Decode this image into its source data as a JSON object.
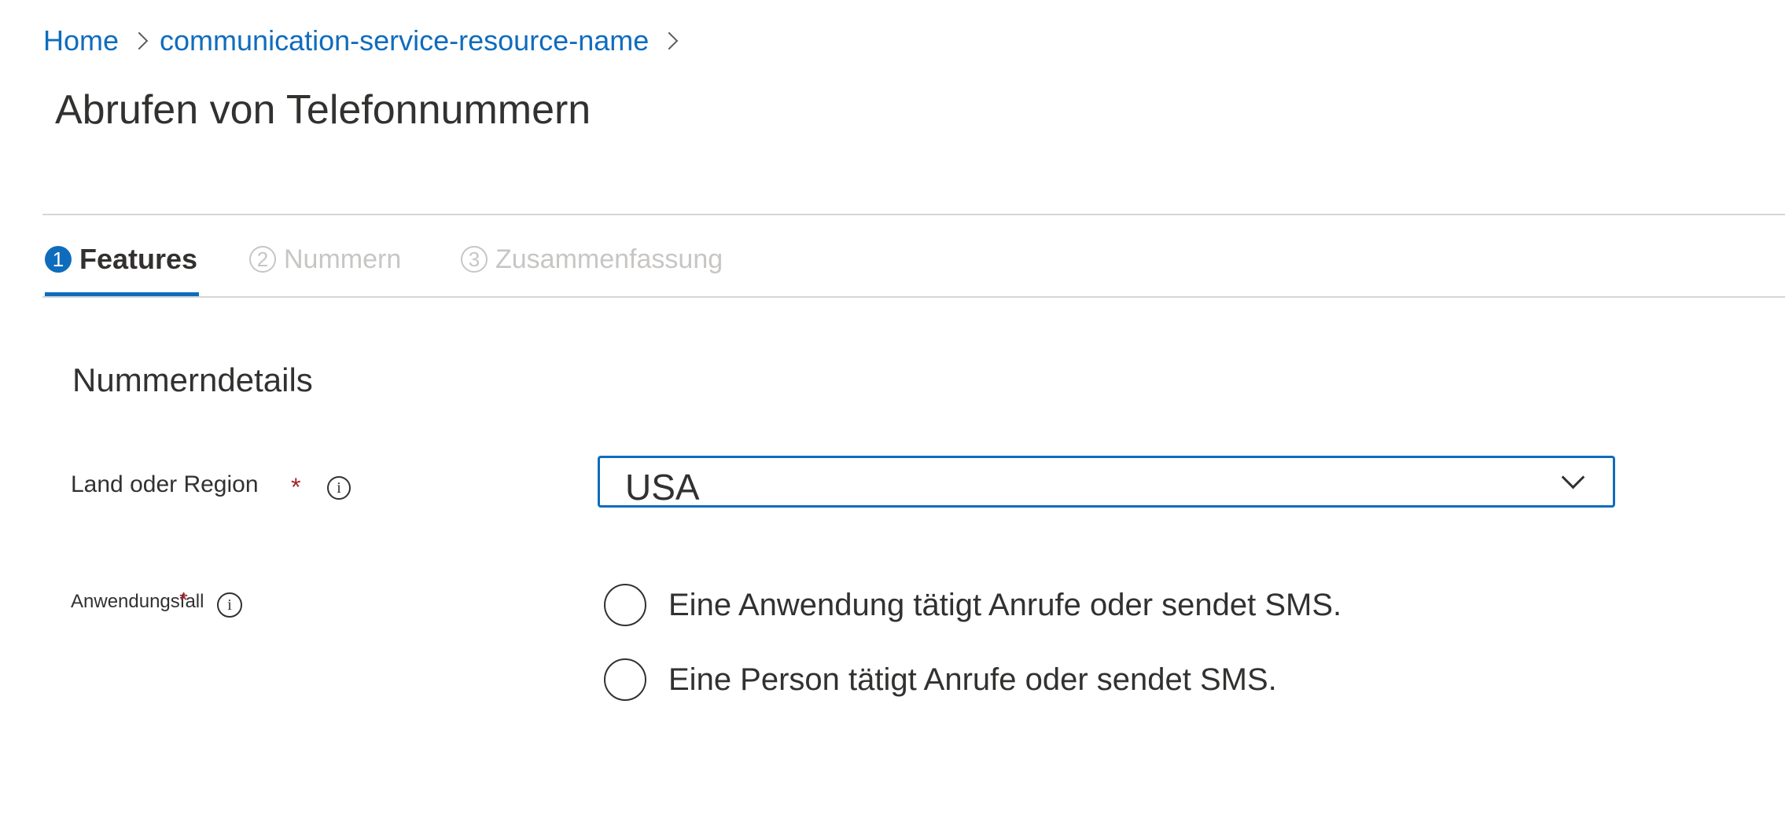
{
  "breadcrumb": {
    "home": "Home",
    "resource": "communication-service-resource-name"
  },
  "page_title": "Abrufen von Telefonnummern",
  "tabs": [
    {
      "number": "1",
      "label": "Features",
      "active": true
    },
    {
      "number": "2",
      "label": "Nummern",
      "active": false
    },
    {
      "number": "3",
      "label": "Zusammenfassung",
      "active": false
    }
  ],
  "section_title": "Nummerndetails",
  "fields": {
    "country": {
      "label": "Land oder Region",
      "required_mark": "*",
      "info_glyph": "i",
      "selected_value": "USA"
    },
    "use_case": {
      "label": "Anwendungsfall",
      "required_mark": "*",
      "info_glyph": "i",
      "options": [
        "Eine Anwendung tätigt Anrufe oder sendet SMS.",
        "Eine Person tätigt Anrufe oder sendet SMS."
      ]
    }
  },
  "colors": {
    "accent": "#0f6cbd",
    "required": "#a4262c",
    "text": "#323130",
    "disabled": "#c8c6c4"
  }
}
